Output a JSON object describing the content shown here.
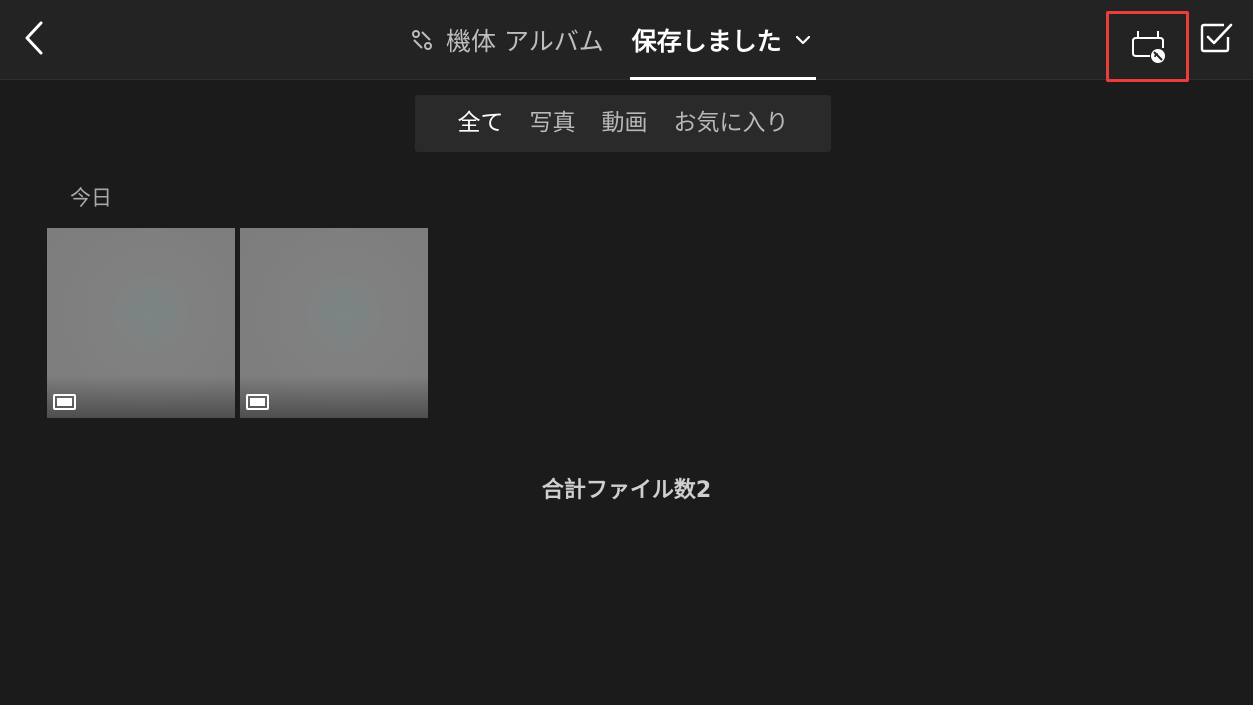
{
  "header": {
    "tabs": [
      {
        "label": "機体 アルバム",
        "icon": "drone-icon",
        "active": false
      },
      {
        "label": "保存しました",
        "icon": "chevron-down-icon",
        "active": true
      }
    ],
    "back_icon": "chevron-left-icon",
    "remote_controller_icon": "rc-no-connection-icon",
    "select_icon": "checkbox-icon",
    "highlight_color": "#ee3b3b"
  },
  "filters": [
    {
      "label": "全て",
      "active": true
    },
    {
      "label": "写真",
      "active": false
    },
    {
      "label": "動画",
      "active": false
    },
    {
      "label": "お気に入り",
      "active": false
    }
  ],
  "groups": [
    {
      "date_label": "今日",
      "items": [
        {
          "type": "photo",
          "icon": "photo-type-icon"
        },
        {
          "type": "photo",
          "icon": "photo-type-icon"
        }
      ]
    }
  ],
  "footer": {
    "total_label": "合計ファイル数2"
  }
}
